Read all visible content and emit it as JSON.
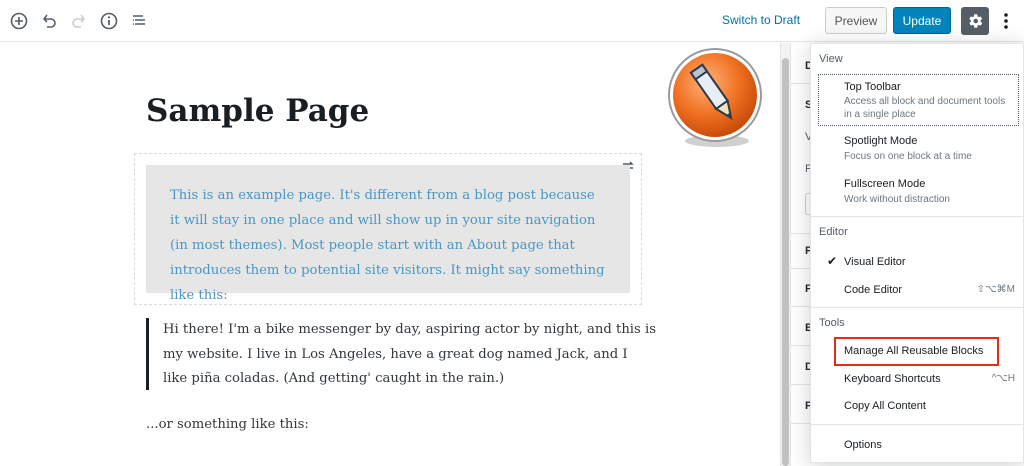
{
  "toolbar": {
    "switch_to_draft": "Switch to Draft",
    "preview_label": "Preview",
    "update_label": "Update"
  },
  "editor": {
    "title": "Sample Page",
    "quote_text": "This is an example page. It's different from a blog post because it will stay in one place and will show up in your site navigation (in most themes). Most people start with an About page that introduces them to potential site visitors. It might say something like this:",
    "pullquote_text": "Hi there! I'm a bike messenger by day, aspiring actor by night, and this is my website. I live in Los Angeles, have a great dog named Jack, and I like piña coladas. (And getting' caught in the rain.)",
    "plain_text": "...or something like this:"
  },
  "sidebar": {
    "letters": [
      "D",
      "S",
      "V",
      "P",
      "P",
      "F",
      "E",
      "D",
      "P"
    ]
  },
  "menu": {
    "view_label": "View",
    "top_toolbar": "Top Toolbar",
    "top_toolbar_desc": "Access all block and document tools in a single place",
    "spotlight": "Spotlight Mode",
    "spotlight_desc": "Focus on one block at a time",
    "fullscreen": "Fullscreen Mode",
    "fullscreen_desc": "Work without distraction",
    "editor_label": "Editor",
    "visual_editor": "Visual Editor",
    "code_editor": "Code Editor",
    "code_editor_shortcut": "⇧⌥⌘M",
    "tools_label": "Tools",
    "manage_reusable": "Manage All Reusable Blocks",
    "keyboard_shortcuts": "Keyboard Shortcuts",
    "keyboard_shortcut_keys": "^⌥H",
    "copy_all": "Copy All Content",
    "options": "Options"
  },
  "colors": {
    "accent": "#0085ba",
    "link": "#0073aa",
    "highlight": "#e32d1b",
    "quote_text": "#4a97c2"
  }
}
